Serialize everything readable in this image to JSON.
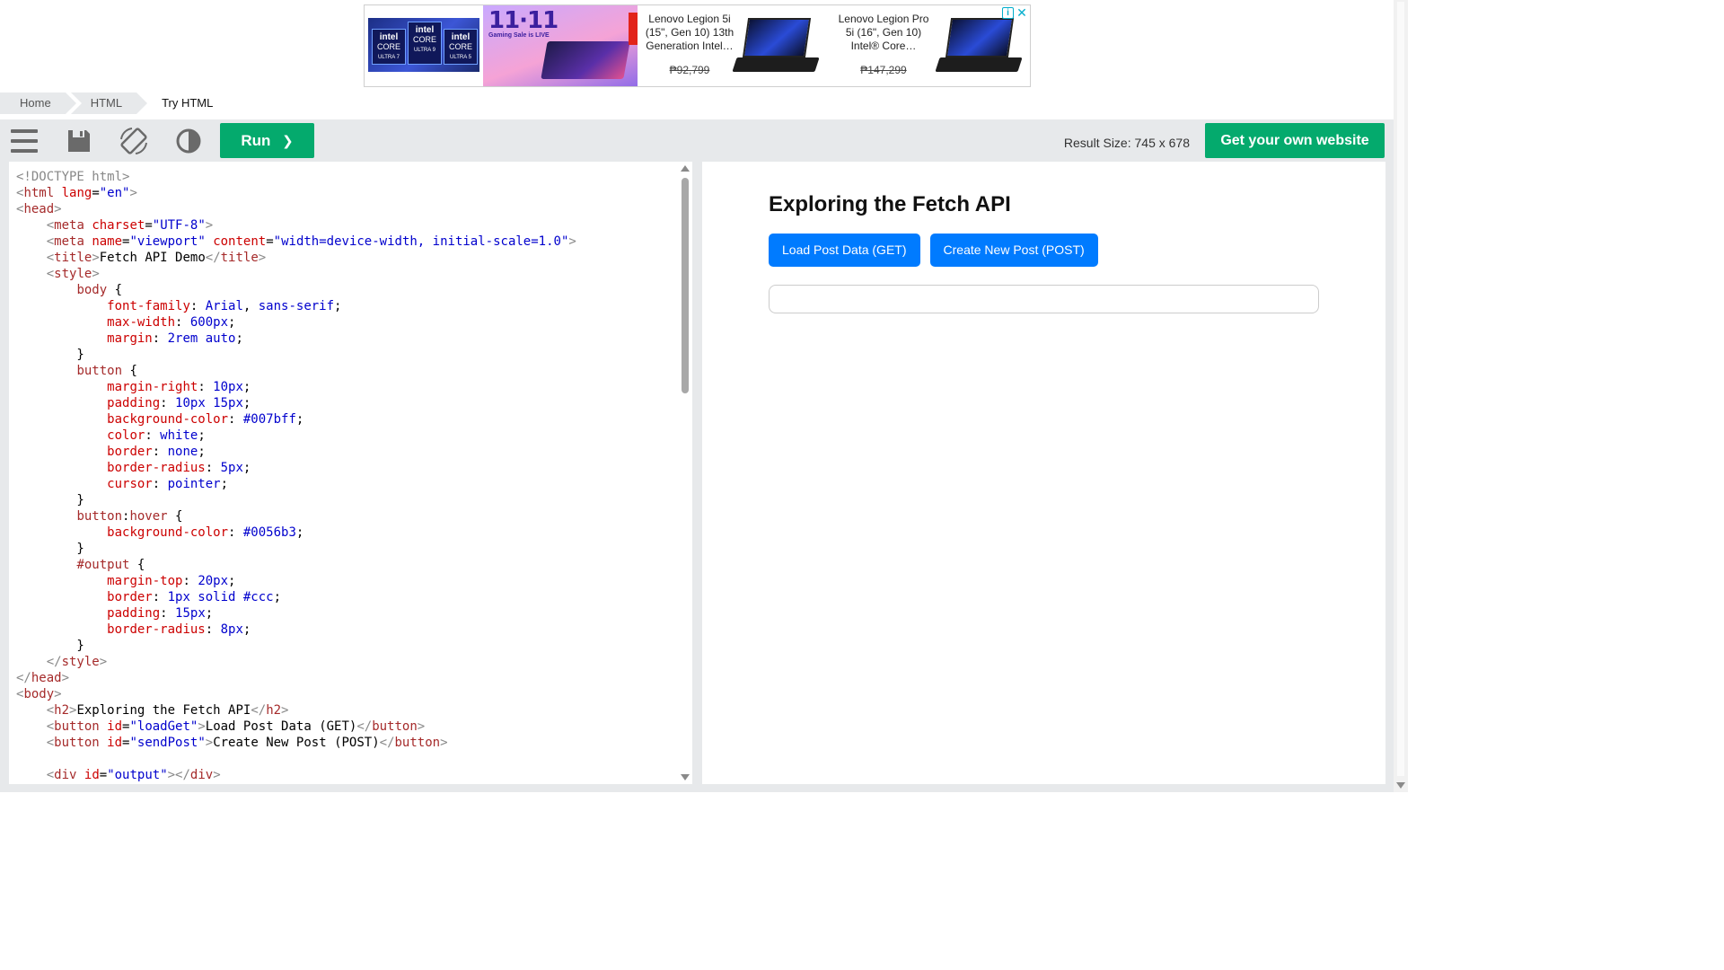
{
  "ad": {
    "sale_headline": "11·11",
    "sale_subtitle": "Gaming Sale is LIVE",
    "intel_chips": [
      {
        "brand": "intel",
        "line": "CORE",
        "tier": "ULTRA 7"
      },
      {
        "brand": "intel",
        "line": "CORE",
        "tier": "ULTRA 9"
      },
      {
        "brand": "intel",
        "line": "CORE",
        "tier": "ULTRA 5"
      }
    ],
    "products": [
      {
        "name": "Lenovo Legion 5i (15\", Gen 10) 13th Generation Intel…",
        "price": "₱92,799"
      },
      {
        "name": "Lenovo Legion Pro 5i (16\", Gen 10) Intel® Core…",
        "price": "₱147,299"
      }
    ],
    "info_icon": "i",
    "close_icon": "✕",
    "colors": {
      "accent": "#00aecd",
      "brand_red": "#e2231a"
    }
  },
  "breadcrumb": [
    {
      "label": "Home"
    },
    {
      "label": "HTML"
    },
    {
      "label": "Try HTML"
    }
  ],
  "toolbar": {
    "icons": [
      "menu-icon",
      "save-icon",
      "orientation-icon",
      "contrast-icon"
    ],
    "run_label": "Run",
    "run_arrow": "❯",
    "result_size": "Result Size: 745 x 678",
    "get_website_label": "Get your own website",
    "colors": {
      "green": "#04aa6d",
      "bar": "#e7e9eb"
    }
  },
  "editor": {
    "lines": [
      [
        [
          "t-br",
          "<!DOCTYPE html>"
        ]
      ],
      [
        [
          "t-br",
          "<"
        ],
        [
          "t-tag",
          "html"
        ],
        [
          "t-txt",
          " "
        ],
        [
          "t-attr",
          "lang"
        ],
        [
          "t-txt",
          "="
        ],
        [
          "t-val",
          "\"en\""
        ],
        [
          "t-br",
          ">"
        ]
      ],
      [
        [
          "t-br",
          "<"
        ],
        [
          "t-tag",
          "head"
        ],
        [
          "t-br",
          ">"
        ]
      ],
      [
        [
          "t-txt",
          "    "
        ],
        [
          "t-br",
          "<"
        ],
        [
          "t-tag",
          "meta"
        ],
        [
          "t-txt",
          " "
        ],
        [
          "t-attr",
          "charset"
        ],
        [
          "t-txt",
          "="
        ],
        [
          "t-val",
          "\"UTF-8\""
        ],
        [
          "t-br",
          ">"
        ]
      ],
      [
        [
          "t-txt",
          "    "
        ],
        [
          "t-br",
          "<"
        ],
        [
          "t-tag",
          "meta"
        ],
        [
          "t-txt",
          " "
        ],
        [
          "t-attr",
          "name"
        ],
        [
          "t-txt",
          "="
        ],
        [
          "t-val",
          "\"viewport\""
        ],
        [
          "t-txt",
          " "
        ],
        [
          "t-attr",
          "content"
        ],
        [
          "t-txt",
          "="
        ],
        [
          "t-val",
          "\"width=device-width, initial-scale=1.0\""
        ],
        [
          "t-br",
          ">"
        ]
      ],
      [
        [
          "t-txt",
          "    "
        ],
        [
          "t-br",
          "<"
        ],
        [
          "t-tag",
          "title"
        ],
        [
          "t-br",
          ">"
        ],
        [
          "t-txt",
          "Fetch API Demo"
        ],
        [
          "t-br",
          "</"
        ],
        [
          "t-tag",
          "title"
        ],
        [
          "t-br",
          ">"
        ]
      ],
      [
        [
          "t-txt",
          "    "
        ],
        [
          "t-br",
          "<"
        ],
        [
          "t-tag",
          "style"
        ],
        [
          "t-br",
          ">"
        ]
      ],
      [
        [
          "t-txt",
          "        "
        ],
        [
          "t-sel",
          "body"
        ],
        [
          "t-txt",
          " {"
        ]
      ],
      [
        [
          "t-txt",
          "            "
        ],
        [
          "t-prop",
          "font-family"
        ],
        [
          "t-txt",
          ": "
        ],
        [
          "t-pval",
          "Arial"
        ],
        [
          "t-txt",
          ", "
        ],
        [
          "t-pval",
          "sans-serif"
        ],
        [
          "t-txt",
          ";"
        ]
      ],
      [
        [
          "t-txt",
          "            "
        ],
        [
          "t-prop",
          "max-width"
        ],
        [
          "t-txt",
          ": "
        ],
        [
          "t-pval",
          "600px"
        ],
        [
          "t-txt",
          ";"
        ]
      ],
      [
        [
          "t-txt",
          "            "
        ],
        [
          "t-prop",
          "margin"
        ],
        [
          "t-txt",
          ": "
        ],
        [
          "t-pval",
          "2rem auto"
        ],
        [
          "t-txt",
          ";"
        ]
      ],
      [
        [
          "t-txt",
          "        }"
        ]
      ],
      [
        [
          "t-txt",
          "        "
        ],
        [
          "t-sel",
          "button"
        ],
        [
          "t-txt",
          " {"
        ]
      ],
      [
        [
          "t-txt",
          "            "
        ],
        [
          "t-prop",
          "margin-right"
        ],
        [
          "t-txt",
          ": "
        ],
        [
          "t-pval",
          "10px"
        ],
        [
          "t-txt",
          ";"
        ]
      ],
      [
        [
          "t-txt",
          "            "
        ],
        [
          "t-prop",
          "padding"
        ],
        [
          "t-txt",
          ": "
        ],
        [
          "t-pval",
          "10px 15px"
        ],
        [
          "t-txt",
          ";"
        ]
      ],
      [
        [
          "t-txt",
          "            "
        ],
        [
          "t-prop",
          "background-color"
        ],
        [
          "t-txt",
          ": "
        ],
        [
          "t-pval",
          "#007bff"
        ],
        [
          "t-txt",
          ";"
        ]
      ],
      [
        [
          "t-txt",
          "            "
        ],
        [
          "t-prop",
          "color"
        ],
        [
          "t-txt",
          ": "
        ],
        [
          "t-pval",
          "white"
        ],
        [
          "t-txt",
          ";"
        ]
      ],
      [
        [
          "t-txt",
          "            "
        ],
        [
          "t-prop",
          "border"
        ],
        [
          "t-txt",
          ": "
        ],
        [
          "t-pval",
          "none"
        ],
        [
          "t-txt",
          ";"
        ]
      ],
      [
        [
          "t-txt",
          "            "
        ],
        [
          "t-prop",
          "border-radius"
        ],
        [
          "t-txt",
          ": "
        ],
        [
          "t-pval",
          "5px"
        ],
        [
          "t-txt",
          ";"
        ]
      ],
      [
        [
          "t-txt",
          "            "
        ],
        [
          "t-prop",
          "cursor"
        ],
        [
          "t-txt",
          ": "
        ],
        [
          "t-pval",
          "pointer"
        ],
        [
          "t-txt",
          ";"
        ]
      ],
      [
        [
          "t-txt",
          "        }"
        ]
      ],
      [
        [
          "t-txt",
          "        "
        ],
        [
          "t-sel",
          "button"
        ],
        [
          "t-txt",
          ":"
        ],
        [
          "t-sel",
          "hover"
        ],
        [
          "t-txt",
          " {"
        ]
      ],
      [
        [
          "t-txt",
          "            "
        ],
        [
          "t-prop",
          "background-color"
        ],
        [
          "t-txt",
          ": "
        ],
        [
          "t-pval",
          "#0056b3"
        ],
        [
          "t-txt",
          ";"
        ]
      ],
      [
        [
          "t-txt",
          "        }"
        ]
      ],
      [
        [
          "t-txt",
          "        "
        ],
        [
          "t-sel",
          "#output"
        ],
        [
          "t-txt",
          " {"
        ]
      ],
      [
        [
          "t-txt",
          "            "
        ],
        [
          "t-prop",
          "margin-top"
        ],
        [
          "t-txt",
          ": "
        ],
        [
          "t-pval",
          "20px"
        ],
        [
          "t-txt",
          ";"
        ]
      ],
      [
        [
          "t-txt",
          "            "
        ],
        [
          "t-prop",
          "border"
        ],
        [
          "t-txt",
          ": "
        ],
        [
          "t-pval",
          "1px solid #ccc"
        ],
        [
          "t-txt",
          ";"
        ]
      ],
      [
        [
          "t-txt",
          "            "
        ],
        [
          "t-prop",
          "padding"
        ],
        [
          "t-txt",
          ": "
        ],
        [
          "t-pval",
          "15px"
        ],
        [
          "t-txt",
          ";"
        ]
      ],
      [
        [
          "t-txt",
          "            "
        ],
        [
          "t-prop",
          "border-radius"
        ],
        [
          "t-txt",
          ": "
        ],
        [
          "t-pval",
          "8px"
        ],
        [
          "t-txt",
          ";"
        ]
      ],
      [
        [
          "t-txt",
          "        }"
        ]
      ],
      [
        [
          "t-txt",
          "    "
        ],
        [
          "t-br",
          "</"
        ],
        [
          "t-tag",
          "style"
        ],
        [
          "t-br",
          ">"
        ]
      ],
      [
        [
          "t-br",
          "</"
        ],
        [
          "t-tag",
          "head"
        ],
        [
          "t-br",
          ">"
        ]
      ],
      [
        [
          "t-br",
          "<"
        ],
        [
          "t-tag",
          "body"
        ],
        [
          "t-br",
          ">"
        ]
      ],
      [
        [
          "t-txt",
          "    "
        ],
        [
          "t-br",
          "<"
        ],
        [
          "t-tag",
          "h2"
        ],
        [
          "t-br",
          ">"
        ],
        [
          "t-txt",
          "Exploring the Fetch API"
        ],
        [
          "t-br",
          "</"
        ],
        [
          "t-tag",
          "h2"
        ],
        [
          "t-br",
          ">"
        ]
      ],
      [
        [
          "t-txt",
          "    "
        ],
        [
          "t-br",
          "<"
        ],
        [
          "t-tag",
          "button"
        ],
        [
          "t-txt",
          " "
        ],
        [
          "t-attr",
          "id"
        ],
        [
          "t-txt",
          "="
        ],
        [
          "t-val",
          "\"loadGet\""
        ],
        [
          "t-br",
          ">"
        ],
        [
          "t-txt",
          "Load Post Data (GET)"
        ],
        [
          "t-br",
          "</"
        ],
        [
          "t-tag",
          "button"
        ],
        [
          "t-br",
          ">"
        ]
      ],
      [
        [
          "t-txt",
          "    "
        ],
        [
          "t-br",
          "<"
        ],
        [
          "t-tag",
          "button"
        ],
        [
          "t-txt",
          " "
        ],
        [
          "t-attr",
          "id"
        ],
        [
          "t-txt",
          "="
        ],
        [
          "t-val",
          "\"sendPost\""
        ],
        [
          "t-br",
          ">"
        ],
        [
          "t-txt",
          "Create New Post (POST)"
        ],
        [
          "t-br",
          "</"
        ],
        [
          "t-tag",
          "button"
        ],
        [
          "t-br",
          ">"
        ]
      ],
      [
        [
          "t-txt",
          ""
        ]
      ],
      [
        [
          "t-txt",
          "    "
        ],
        [
          "t-br",
          "<"
        ],
        [
          "t-tag",
          "div"
        ],
        [
          "t-txt",
          " "
        ],
        [
          "t-attr",
          "id"
        ],
        [
          "t-txt",
          "="
        ],
        [
          "t-val",
          "\"output\""
        ],
        [
          "t-br",
          "></"
        ],
        [
          "t-tag",
          "div"
        ],
        [
          "t-br",
          ">"
        ]
      ]
    ]
  },
  "result": {
    "heading": "Exploring the Fetch API",
    "buttons": [
      {
        "label": "Load Post Data (GET)"
      },
      {
        "label": "Create New Post (POST)"
      }
    ],
    "output_text": "",
    "colors": {
      "button": "#007bff",
      "output_border": "#ccc"
    }
  }
}
